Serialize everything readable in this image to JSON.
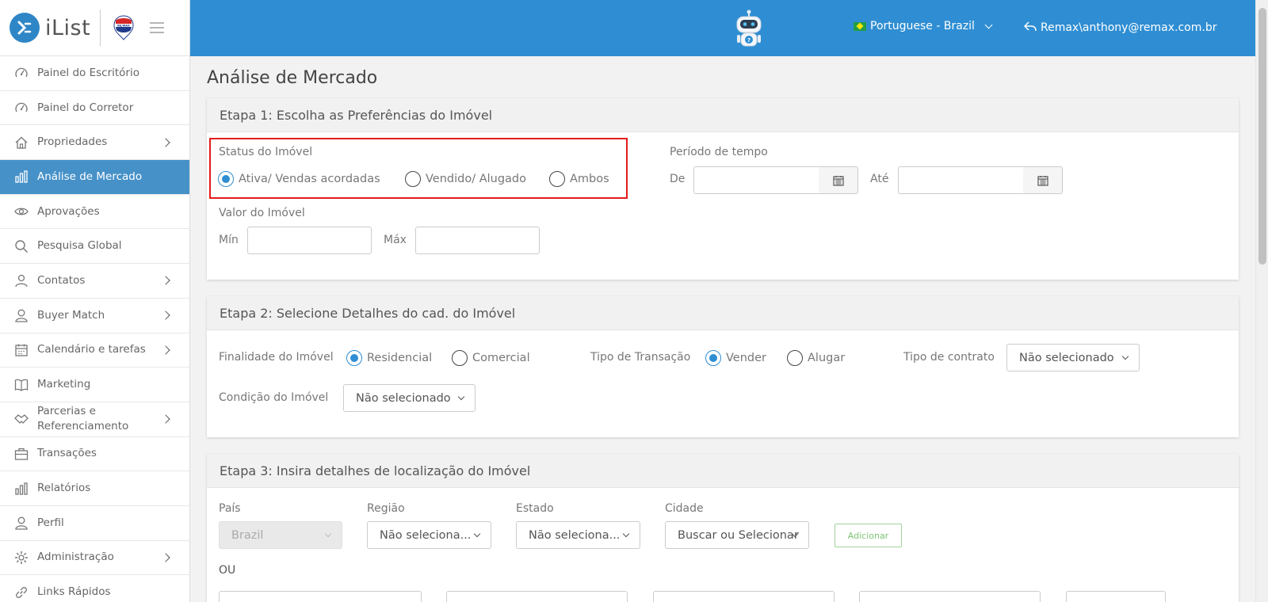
{
  "brand": {
    "name": "iList",
    "logo_letter": "✕",
    "partner": "RE/MAX"
  },
  "sidebar": {
    "items": [
      {
        "label": "Painel do Escritório",
        "icon": "dashboard-icon",
        "chevron": false
      },
      {
        "label": "Painel do Corretor",
        "icon": "dashboard-icon",
        "chevron": false
      },
      {
        "label": "Propriedades",
        "icon": "home-icon",
        "chevron": true
      },
      {
        "label": "Análise de Mercado",
        "icon": "bar-chart-icon",
        "chevron": false,
        "active": true
      },
      {
        "label": "Aprovações",
        "icon": "eye-icon",
        "chevron": false
      },
      {
        "label": "Pesquisa Global",
        "icon": "search-icon",
        "chevron": false
      },
      {
        "label": "Contatos",
        "icon": "contacts-icon",
        "chevron": true
      },
      {
        "label": "Buyer Match",
        "icon": "user-icon",
        "chevron": true
      },
      {
        "label": "Calendário e tarefas",
        "icon": "calendar-icon",
        "chevron": true
      },
      {
        "label": "Marketing",
        "icon": "book-icon",
        "chevron": false
      },
      {
        "label": "Parcerias e Referenciamento",
        "icon": "handshake-icon",
        "chevron": true
      },
      {
        "label": "Transações",
        "icon": "briefcase-icon",
        "chevron": false
      },
      {
        "label": "Relatórios",
        "icon": "bar-chart-icon",
        "chevron": false
      },
      {
        "label": "Perfil",
        "icon": "user-icon",
        "chevron": false
      },
      {
        "label": "Administração",
        "icon": "gear-icon",
        "chevron": true
      },
      {
        "label": "Links Rápidos",
        "icon": "link-icon",
        "chevron": false
      }
    ]
  },
  "header": {
    "language": "Portuguese - Brazil",
    "user": "Remax\\anthony@remax.com.br",
    "accent": "#2f8ed3"
  },
  "page": {
    "title": "Análise de Mercado"
  },
  "step1": {
    "title": "Etapa 1: Escolha as Preferências do Imóvel",
    "status_label": "Status do Imóvel",
    "status_options": [
      "Ativa/ Vendas acordadas",
      "Vendido/ Alugado",
      "Ambos"
    ],
    "status_selected": "Ativa/ Vendas acordadas",
    "period_label": "Período de tempo",
    "from_label": "De",
    "to_label": "Até",
    "from_value": "",
    "to_value": "",
    "value_label": "Valor do Imóvel",
    "min_label": "Mín",
    "max_label": "Máx",
    "min_value": "",
    "max_value": ""
  },
  "step2": {
    "title": "Etapa 2: Selecione Detalhes do cad. do Imóvel",
    "purpose_label": "Finalidade do Imóvel",
    "purpose_options": [
      "Residencial",
      "Comercial"
    ],
    "purpose_selected": "Residencial",
    "transaction_label": "Tipo de Transação",
    "transaction_options": [
      "Vender",
      "Alugar"
    ],
    "transaction_selected": "Vender",
    "contract_label": "Tipo de contrato",
    "contract_value": "Não selecionado",
    "condition_label": "Condição do Imóvel",
    "condition_value": "Não selecionado"
  },
  "step3": {
    "title": "Etapa 3: Insira detalhes de localização do Imóvel",
    "country_label": "País",
    "country_value": "Brazil",
    "region_label": "Região",
    "region_value": "Não seleciona...",
    "state_label": "Estado",
    "state_value": "Não seleciona...",
    "city_label": "Cidade",
    "city_value": "Buscar ou Selecionar",
    "add_label": "Adicionar",
    "or_label": "OU"
  }
}
